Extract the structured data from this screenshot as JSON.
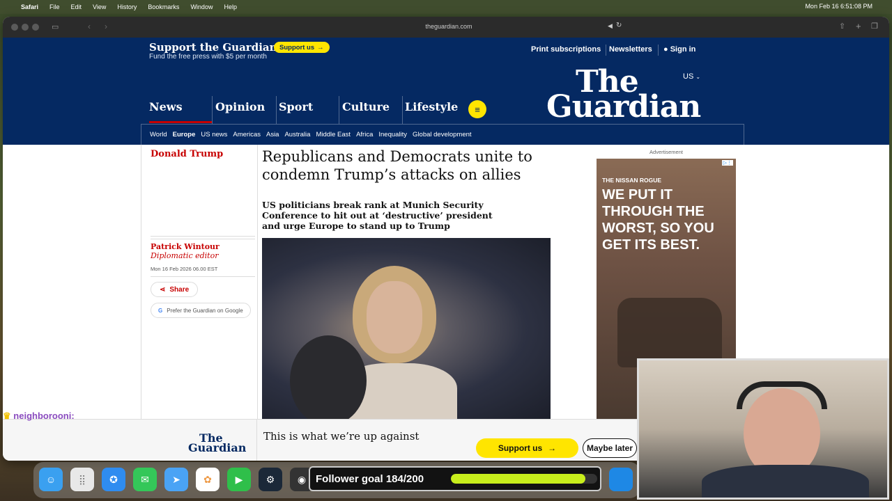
{
  "menubar": {
    "items": [
      "Safari",
      "File",
      "Edit",
      "View",
      "History",
      "Bookmarks",
      "Window",
      "Help"
    ],
    "clock": "Mon Feb 16  6:51:08 PM"
  },
  "browser": {
    "url": "theguardian.com"
  },
  "header": {
    "support_title": "Support the Guardian",
    "support_sub": "Fund the free press with $5 per month",
    "support_btn": "Support us",
    "print": "Print subscriptions",
    "newsletters": "Newsletters",
    "signin": "Sign in",
    "logo_line1": "The",
    "logo_line2": "Guardian",
    "edition": "US",
    "pillars": [
      "News",
      "Opinion",
      "Sport",
      "Culture",
      "Lifestyle"
    ],
    "subnav": [
      "World",
      "Europe",
      "US news",
      "Americas",
      "Asia",
      "Australia",
      "Middle East",
      "Africa",
      "Inequality",
      "Global development"
    ]
  },
  "article": {
    "kicker": "Donald Trump",
    "headline": "Republicans and Democrats unite to condemn Trump’s attacks on allies",
    "standfirst": "US politicians break rank at Munich Security Conference to hit out at ‘destructive’ president and urge Europe to stand up to Trump",
    "author": "Patrick Wintour",
    "role": "Diplomatic editor",
    "date": "Mon 16 Feb 2026 06.00 EST",
    "share": "Share",
    "prefer": "Prefer the Guardian on Google"
  },
  "ad": {
    "label": "Advertisement",
    "brand": "THE NISSAN ROGUE",
    "headline": "WE PUT IT THROUGH THE WORST, SO YOU GET ITS BEST."
  },
  "banner": {
    "logo_line1": "The",
    "logo_line2": "Guardian",
    "text": "This is what we’re up against",
    "support": "Support us",
    "later": "Maybe later"
  },
  "overlay": {
    "chat_user": "neighborooni:",
    "follower_text": "Follower goal 184/200",
    "follower_progress": 0.92
  },
  "colors": {
    "guardian_blue": "#052962",
    "accent_red": "#c70000",
    "yellow": "#ffe500"
  }
}
